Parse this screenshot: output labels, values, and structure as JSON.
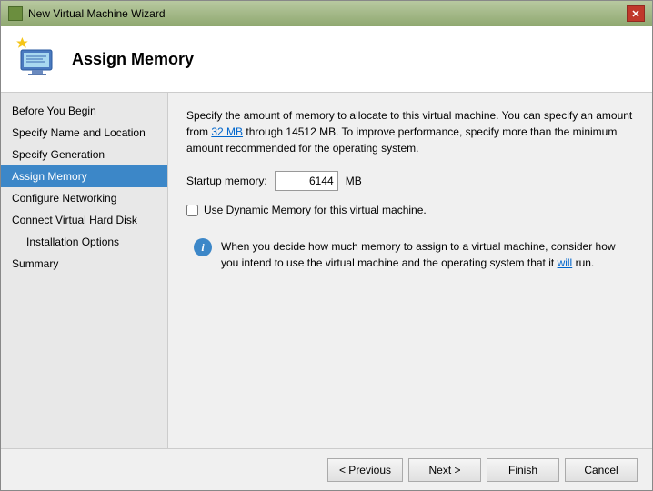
{
  "window": {
    "title": "New Virtual Machine Wizard",
    "close_label": "✕"
  },
  "header": {
    "title": "Assign Memory"
  },
  "sidebar": {
    "items": [
      {
        "id": "before-you-begin",
        "label": "Before You Begin",
        "active": false,
        "sub": false
      },
      {
        "id": "specify-name-and-location",
        "label": "Specify Name and Location",
        "active": false,
        "sub": false
      },
      {
        "id": "specify-generation",
        "label": "Specify Generation",
        "active": false,
        "sub": false
      },
      {
        "id": "assign-memory",
        "label": "Assign Memory",
        "active": true,
        "sub": false
      },
      {
        "id": "configure-networking",
        "label": "Configure Networking",
        "active": false,
        "sub": false
      },
      {
        "id": "connect-virtual-hard-disk",
        "label": "Connect Virtual Hard Disk",
        "active": false,
        "sub": false
      },
      {
        "id": "installation-options",
        "label": "Installation Options",
        "active": false,
        "sub": true
      },
      {
        "id": "summary",
        "label": "Summary",
        "active": false,
        "sub": false
      }
    ]
  },
  "main": {
    "description": "Specify the amount of memory to allocate to this virtual machine. You can specify an amount from 32 MB through 14512 MB. To improve performance, specify more than the minimum amount recommended for the operating system.",
    "description_link_text": "32 MB",
    "startup_memory_label": "Startup memory:",
    "startup_memory_value": "6144",
    "mb_label": "MB",
    "checkbox_label": "Use Dynamic Memory for this virtual machine.",
    "info_text": "When you decide how much memory to assign to a virtual machine, consider how you intend to use the virtual machine and the operating system that it will run.",
    "info_text_link": "will"
  },
  "footer": {
    "previous_label": "< Previous",
    "next_label": "Next >",
    "finish_label": "Finish",
    "cancel_label": "Cancel"
  }
}
